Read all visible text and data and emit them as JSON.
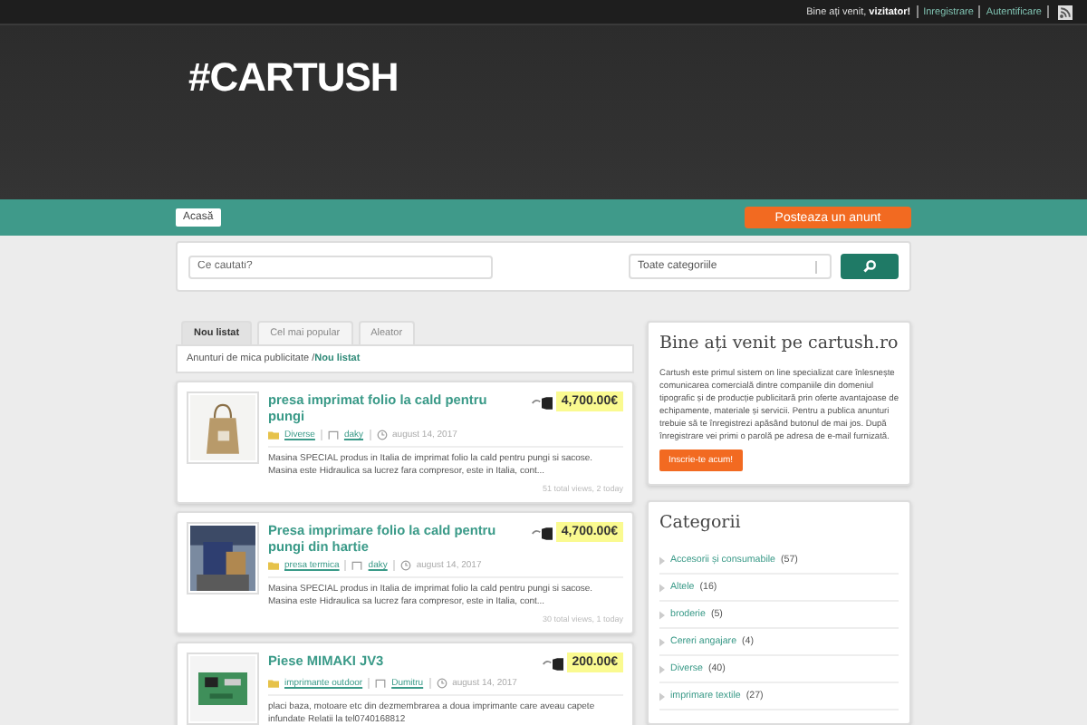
{
  "top_bar": {
    "greeting": "Bine ați venit, **vizitator!**",
    "links": [
      "Inregistrare",
      "Autentificare"
    ]
  },
  "logo": "#CARTUSH",
  "nav": {
    "home": "Acasă",
    "post_button": "Posteaza un anunt"
  },
  "search": {
    "placeholder": "Ce cautati?",
    "category": "Toate categoriile"
  },
  "tabs": [
    {
      "label": "Nou listat",
      "selected": true
    },
    {
      "label": "Cel mai popular",
      "selected": false
    },
    {
      "label": "Aleator",
      "selected": false
    }
  ],
  "breadcrumb": {
    "root": "Anunturi de mica publicitate",
    "separator": "/",
    "current": "Nou listat"
  },
  "ads": [
    {
      "title": "presa imprimat folio la cald pentru pungi",
      "price": "4,700.00€",
      "category": "Diverse",
      "user": "daky",
      "date": "august 14, 2017",
      "description": "Masina SPECIAL produs in Italia de imprimat folio la cald pentru pungi si sacose. Masina este Hidraulica sa lucrez fara compresor, este in Italia, cont...",
      "stats": "51 total views, 2 today"
    },
    {
      "title": "Presa imprimare folio la cald pentru pungi din hartie",
      "price": "4,700.00€",
      "category": "presa termica",
      "user": "daky",
      "date": "august 14, 2017",
      "description": "Masina SPECIAL produs in Italia de imprimat folio la cald pentru pungi si sacose. Masina este Hidraulica sa lucrez fara compresor, este in Italia, cont...",
      "stats": "30 total views, 1 today"
    },
    {
      "title": "Piese MIMAKI JV3",
      "price": "200.00€",
      "category": "imprimante outdoor",
      "user": "Dumitru",
      "date": "august 14, 2017",
      "description": "placi baza, motoare etc din dezmembrarea a doua imprimante care aveau capete infundate Relatii la tel0740168812"
    }
  ],
  "welcome": {
    "title": "Bine ați venit pe cartush.ro",
    "text": "Cartush este primul sistem on line specializat care înlesnește comunicarea comercială dintre companiile din domeniul tipografic și de producție publicitară prin oferte avantajoase de echipamente, materiale și servicii. Pentru a publica anunturi trebuie să te înregistrezi apăsând butonul de mai jos. După înregistrare vei primi o parolă pe adresa de e-mail furnizată.",
    "button": "Inscrie-te acum!"
  },
  "categories": {
    "title": "Categorii",
    "items": [
      {
        "name": "Accesorii și consumabile",
        "count": "(57)"
      },
      {
        "name": "Altele",
        "count": "(16)"
      },
      {
        "name": "broderie",
        "count": "(5)"
      },
      {
        "name": "Cereri angajare",
        "count": "(4)"
      },
      {
        "name": "Diverse",
        "count": "(40)"
      },
      {
        "name": "imprimare textile",
        "count": "(27)"
      }
    ]
  }
}
